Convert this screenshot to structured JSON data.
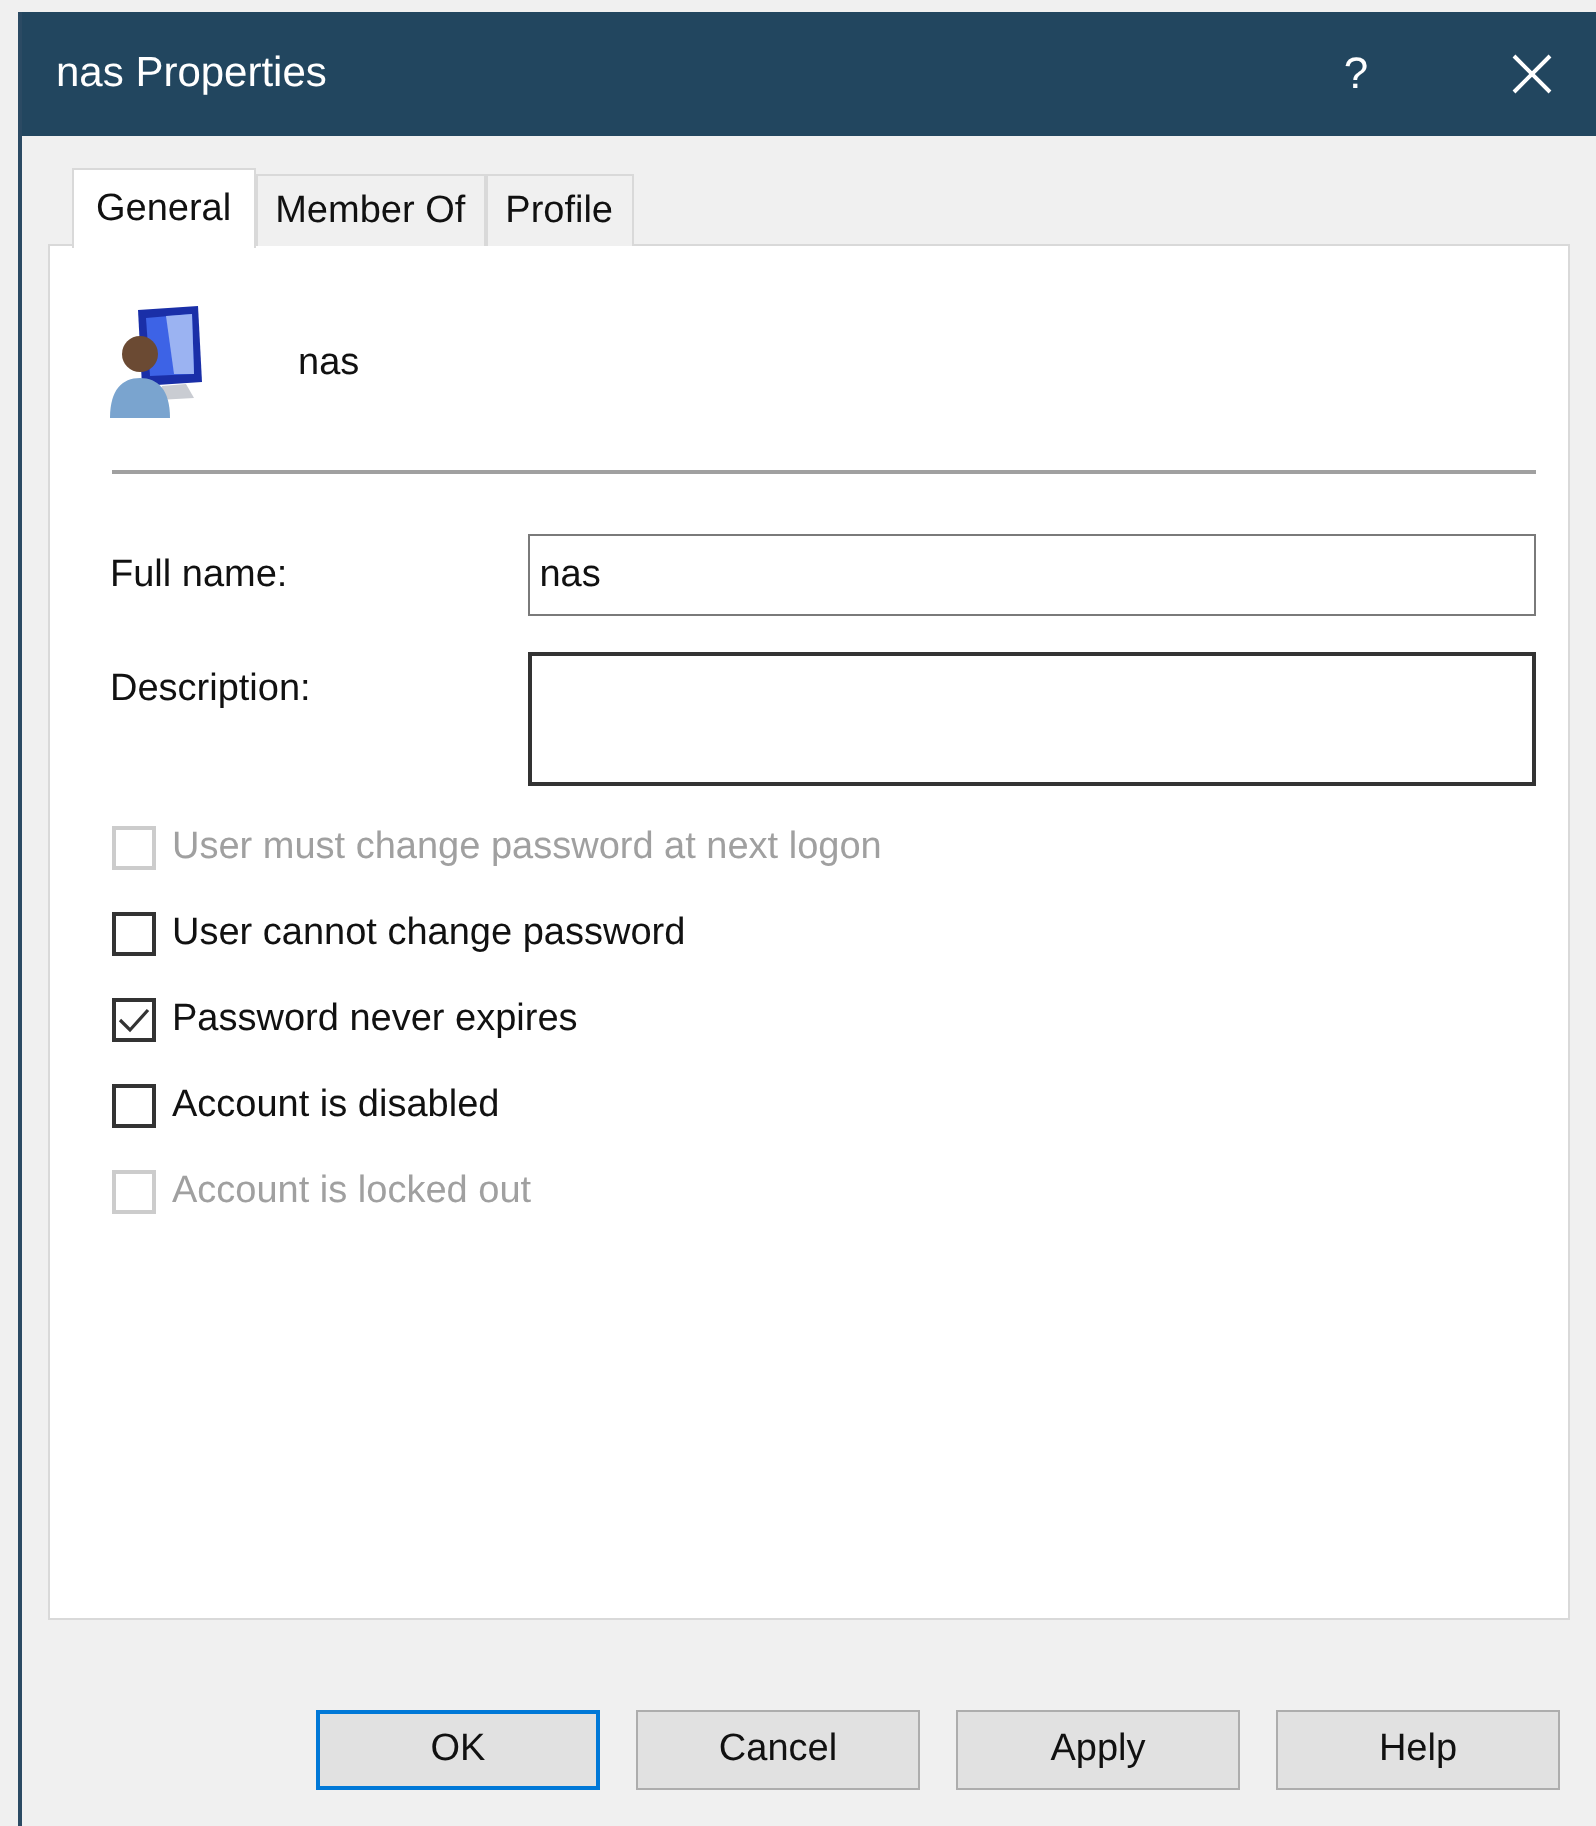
{
  "window": {
    "title": "nas Properties",
    "help_button": "?"
  },
  "tabs": [
    {
      "label": "General",
      "selected": true
    },
    {
      "label": "Member Of",
      "selected": false
    },
    {
      "label": "Profile",
      "selected": false
    }
  ],
  "header": {
    "name": "nas"
  },
  "fields": [
    {
      "label": "Full name:",
      "value": "nas",
      "kind": "single"
    },
    {
      "label": "Description:",
      "kind": "multi"
    }
  ],
  "checkboxes": [
    {
      "label": "User must change password at next logon",
      "checked": false,
      "disabled": true
    },
    {
      "label": "User cannot change password",
      "checked": false,
      "disabled": false
    },
    {
      "label": "Password never expires",
      "checked": true,
      "disabled": false
    },
    {
      "label": "Account is disabled",
      "checked": false,
      "disabled": false
    },
    {
      "label": "Account is locked out",
      "checked": false,
      "disabled": true
    }
  ],
  "buttons": [
    {
      "label": "OK",
      "default": true
    },
    {
      "label": "Cancel",
      "default": false
    },
    {
      "label": "Apply",
      "default": false
    },
    {
      "label": "Help",
      "default": false
    }
  ]
}
